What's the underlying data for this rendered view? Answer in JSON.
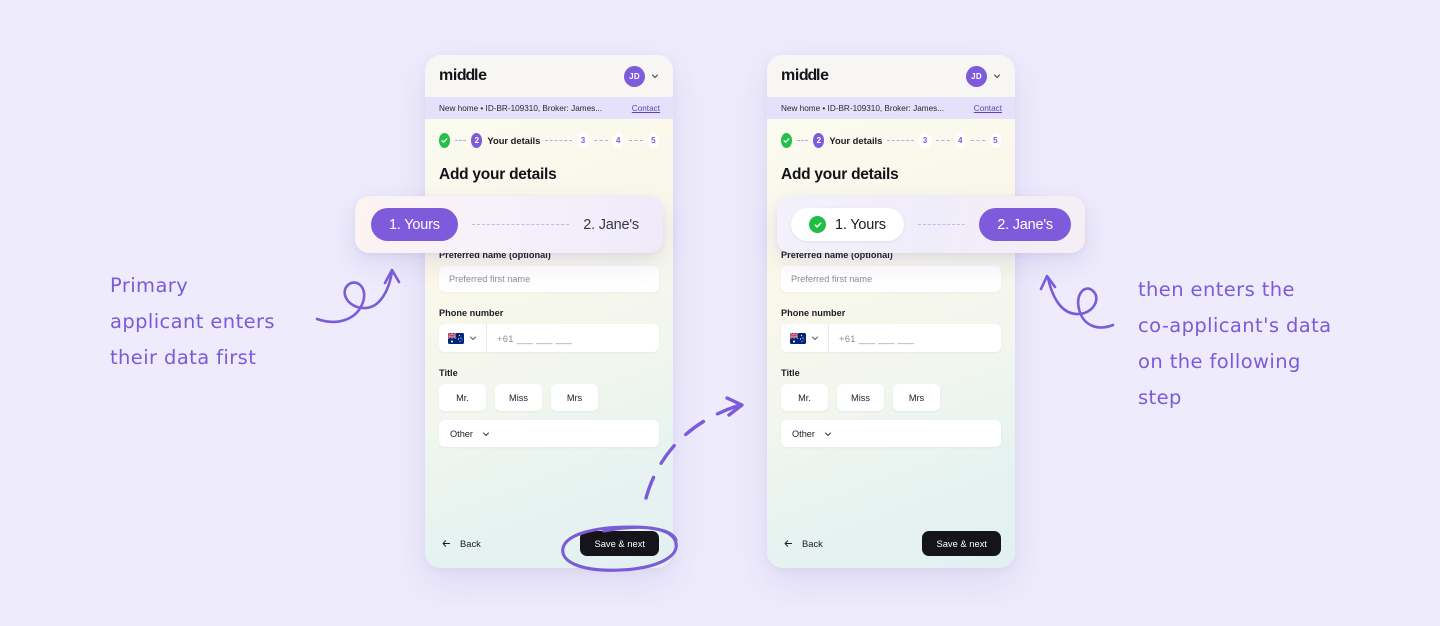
{
  "page": {
    "background_color": "#EEEBFC",
    "accent_purple": "#7E5BDB",
    "accent_green": "#24C04A"
  },
  "phones": [
    {
      "id": "left",
      "topbar": {
        "logo_first": "mi",
        "logo_dd": "dd",
        "logo_last": "le",
        "avatar_initials": "JD",
        "chevron_icon": "chevron-down-icon"
      },
      "subbar": {
        "text": "New home • ID-BR-109310, Broker: James...",
        "link": "Contact"
      },
      "steps": {
        "completed_icon": "check-icon",
        "current_number": "2",
        "current_label": "Your details",
        "upcoming": [
          "3",
          "4",
          "5"
        ]
      },
      "title": "Add your details",
      "applicant_toggle": {
        "first_label": "1. Yours",
        "second_label": "2. Jane's",
        "first_state": "active",
        "second_state": "inactive"
      },
      "fields": {
        "preferred_name_label": "Preferred name (optional)",
        "preferred_name_placeholder": "Preferred first name",
        "phone_label": "Phone number",
        "phone_country_flag": "australia-flag-icon",
        "phone_prefix": "+61",
        "phone_placeholder": "___ ___ ___",
        "title_label": "Title",
        "title_options": [
          "Mr.",
          "Miss",
          "Mrs"
        ],
        "title_other": "Other"
      },
      "footer": {
        "back_label": "Back",
        "back_icon": "arrow-left-icon",
        "save_label": "Save & next"
      }
    },
    {
      "id": "right",
      "topbar": {
        "logo_first": "mi",
        "logo_dd": "dd",
        "logo_last": "le",
        "avatar_initials": "JD",
        "chevron_icon": "chevron-down-icon"
      },
      "subbar": {
        "text": "New home • ID-BR-109310, Broker: James...",
        "link": "Contact"
      },
      "steps": {
        "completed_icon": "check-icon",
        "current_number": "2",
        "current_label": "Your details",
        "upcoming": [
          "3",
          "4",
          "5"
        ]
      },
      "title": "Add your details",
      "applicant_toggle": {
        "first_label": "1. Yours",
        "second_label": "2. Jane's",
        "first_state": "completed",
        "second_state": "active"
      },
      "fields": {
        "preferred_name_label": "Preferred name (optional)",
        "preferred_name_placeholder": "Preferred first name",
        "phone_label": "Phone number",
        "phone_country_flag": "australia-flag-icon",
        "phone_prefix": "+61",
        "phone_placeholder": "___ ___ ___",
        "title_label": "Title",
        "title_options": [
          "Mr.",
          "Miss",
          "Mrs"
        ],
        "title_other": "Other"
      },
      "footer": {
        "back_label": "Back",
        "back_icon": "arrow-left-icon",
        "save_label": "Save & next"
      }
    }
  ],
  "annotations": {
    "left_note": "Primary\napplicant enters\ntheir data first",
    "right_note": "then enters the\nco-applicant's data\non the following\nstep",
    "ink_color": "#7B5BD8",
    "left_arrow_icon": "curved-arrow-up-right-icon",
    "right_arrow_icon": "curved-arrow-up-left-icon",
    "middle_arrow_icon": "dashed-arrow-right-icon",
    "circle_highlight_icon": "hand-drawn-circle-icon"
  }
}
